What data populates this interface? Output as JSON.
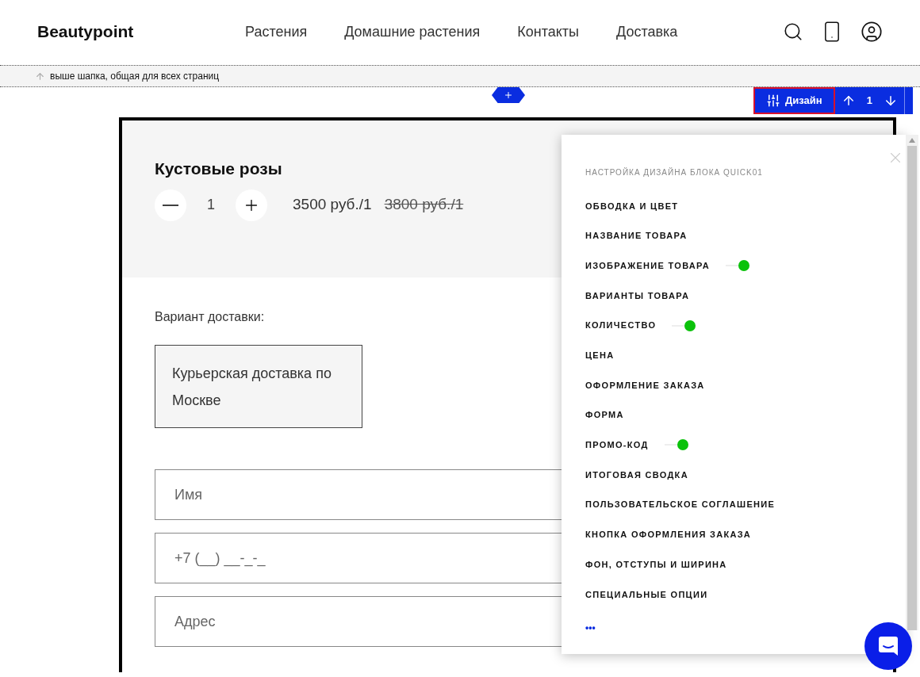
{
  "header": {
    "logo": "Beautypoint",
    "nav": [
      {
        "label": "Растения"
      },
      {
        "label": "Домашние растения"
      },
      {
        "label": "Контакты"
      },
      {
        "label": "Доставка"
      }
    ]
  },
  "header_note": "выше шапка, общая для всех страниц",
  "toolbar": {
    "design_button": "Дизайн",
    "order": "1"
  },
  "product": {
    "title": "Кустовые розы",
    "quantity": "1",
    "price": "3500 руб./1",
    "old_price": "3800 руб./1"
  },
  "delivery": {
    "label": "Вариант доставки:",
    "options": [
      {
        "label": "Курьерская доставка по Москве",
        "selected": true
      }
    ]
  },
  "form": {
    "fields": [
      {
        "placeholder": "Имя"
      },
      {
        "placeholder": "+7 (__) __-_-_"
      },
      {
        "placeholder": "Адрес"
      }
    ]
  },
  "design_panel": {
    "title": "НАСТРОЙКА ДИЗАЙНА БЛОКА QUICK01",
    "items": [
      {
        "label": "ОБВОДКА И ЦВЕТ",
        "kind": "link"
      },
      {
        "label": "НАЗВАНИЕ ТОВАРА",
        "kind": "link"
      },
      {
        "label": "ИЗОБРАЖЕНИЕ ТОВАРА",
        "kind": "switch",
        "on": true
      },
      {
        "label": "ВАРИАНТЫ ТОВАРА",
        "kind": "link"
      },
      {
        "label": "КОЛИЧЕСТВО",
        "kind": "switch",
        "on": true
      },
      {
        "label": "ЦЕНА",
        "kind": "link"
      },
      {
        "label": "ОФОРМЛЕНИЕ ЗАКАЗА",
        "kind": "link"
      },
      {
        "label": "ФОРМА",
        "kind": "link"
      },
      {
        "label": "ПРОМО-КОД",
        "kind": "switch",
        "on": true
      },
      {
        "label": "ИТОГОВАЯ СВОДКА",
        "kind": "link"
      },
      {
        "label": "ПОЛЬЗОВАТЕЛЬСКОЕ СОГЛАШЕНИЕ",
        "kind": "link"
      },
      {
        "label": "КНОПКА ОФОРМЛЕНИЯ ЗАКАЗА",
        "kind": "link"
      },
      {
        "label": "ФОН, ОТСТУПЫ И ШИРИНА",
        "kind": "link"
      },
      {
        "label": "СПЕЦИАЛЬНЫЕ ОПЦИИ",
        "kind": "link"
      }
    ],
    "more": "•••"
  }
}
